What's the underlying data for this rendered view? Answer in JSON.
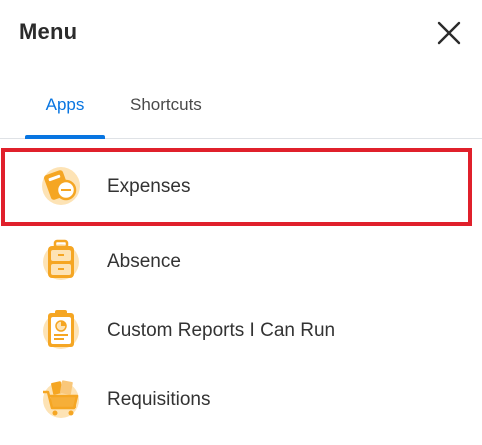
{
  "header": {
    "title": "Menu",
    "close_icon": "close-icon"
  },
  "tabs": [
    {
      "label": "Apps",
      "active": true
    },
    {
      "label": "Shortcuts",
      "active": false
    }
  ],
  "apps": [
    {
      "label": "Expenses",
      "icon": "expenses-icon",
      "selected": true
    },
    {
      "label": "Absence",
      "icon": "absence-icon",
      "selected": false
    },
    {
      "label": "Custom Reports I Can Run",
      "icon": "custom-reports-icon",
      "selected": false
    },
    {
      "label": "Requisitions",
      "icon": "requisitions-icon",
      "selected": false
    }
  ],
  "colors": {
    "accent": "#0875e1",
    "selection_outline": "#e0202b",
    "icon_orange": "#f5a623",
    "icon_light": "#fde3b5"
  }
}
